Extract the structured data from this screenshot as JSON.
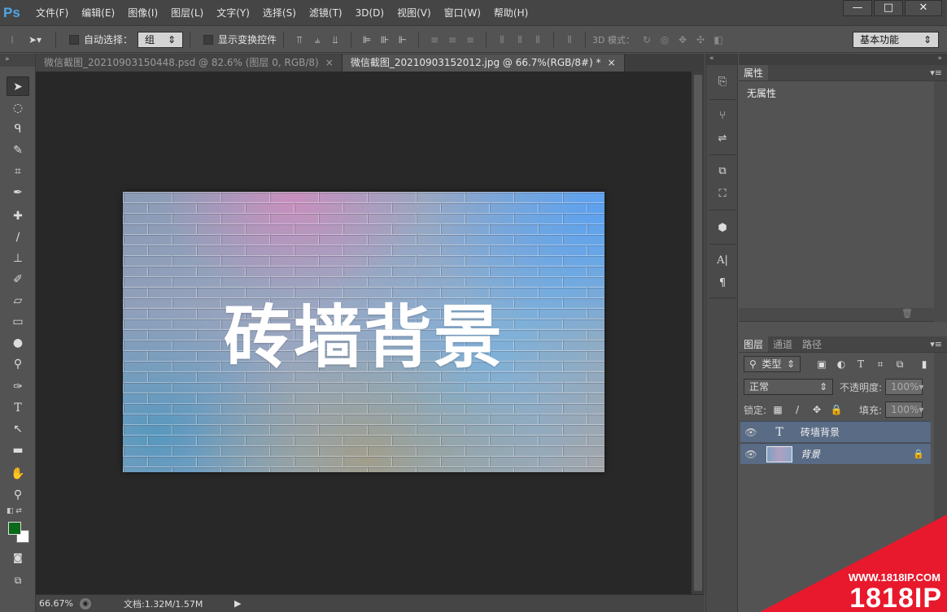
{
  "app": {
    "logo": "Ps"
  },
  "menu": [
    "文件(F)",
    "编辑(E)",
    "图像(I)",
    "图层(L)",
    "文字(Y)",
    "选择(S)",
    "滤镜(T)",
    "3D(D)",
    "视图(V)",
    "窗口(W)",
    "帮助(H)"
  ],
  "window_controls": {
    "minimize": "—",
    "maximize": "□",
    "close": "✕"
  },
  "options": {
    "auto_select_label": "自动选择：",
    "auto_select_value": "组",
    "show_transform_label": "显示变换控件",
    "mode3d_label": "3D 模式：",
    "workspace": "基本功能"
  },
  "tabs": [
    {
      "label": "微信截图_20210903150448.psd @ 82.6% (图层 0, RGB/8)",
      "close": "×"
    },
    {
      "label": "微信截图_20210903152012.jpg @ 66.7%(RGB/8#) *",
      "close": "×"
    }
  ],
  "canvas": {
    "text": "砖墙背景"
  },
  "status": {
    "zoom": "66.67%",
    "doc": "文档:1.32M/1.57M"
  },
  "properties": {
    "tab": "属性",
    "content": "无属性"
  },
  "layers_panel": {
    "tabs": [
      "图层",
      "通道",
      "路径"
    ],
    "filter_kind": "类型",
    "blend_mode": "正常",
    "opacity_label": "不透明度:",
    "opacity_value": "100%",
    "lock_label": "锁定:",
    "fill_label": "填充:",
    "fill_value": "100%",
    "layers": [
      {
        "name": "砖墙背景",
        "type_glyph": "T"
      },
      {
        "name": "背景"
      }
    ]
  },
  "watermark": {
    "url": "WWW.1818IP.COM",
    "brand": "1818IP"
  },
  "colors": {
    "foreground": "#0a6a1a",
    "background": "#ffffff",
    "accent": "#4fa6e8",
    "layer_selected": "#596b85",
    "watermark": "#e8192c"
  }
}
